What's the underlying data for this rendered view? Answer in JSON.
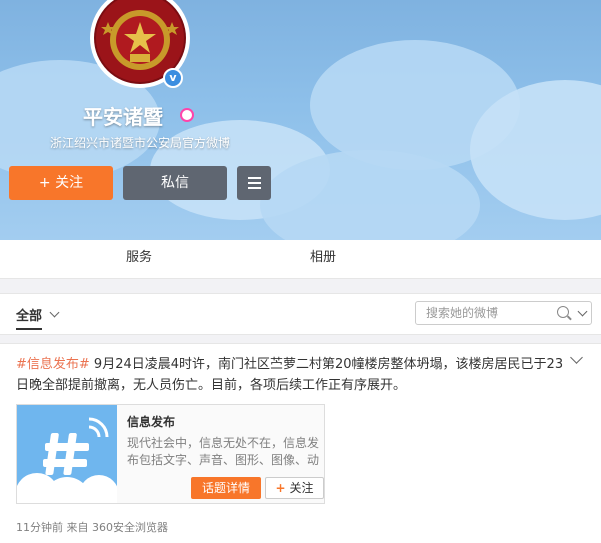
{
  "profile": {
    "name": "平安诸暨",
    "description": "浙江绍兴市诸暨市公安局官方微博",
    "verified_mark": "v"
  },
  "actions": {
    "follow_plus": "+",
    "follow_label": "关注",
    "message_label": "私信",
    "menu_icon": "menu-icon"
  },
  "tabs": [
    {
      "label": "服务"
    },
    {
      "label": "相册"
    }
  ],
  "filter": {
    "selected": "全部",
    "search_placeholder": "搜索她的微博"
  },
  "post": {
    "hashtag": "#信息发布#",
    "text": " 9月24日凌晨4时许，南门社区苎萝二村第20幢楼房整体坍塌，该楼房居民已于23日晚全部提前撤离，无人员伤亡。目前，各项后续工作正有序展开。",
    "link_card": {
      "title": "信息发布",
      "description": "现代社会中，信息无处不在，信息发布包括文字、声音、图形、图像、动",
      "detail_button": "话题详情",
      "follow_plus": "+",
      "follow_label": "关注"
    },
    "meta": "11分钟前 来自 360安全浏览器"
  },
  "colors": {
    "accent_orange": "#f8762a",
    "button_gray": "#5f6671",
    "hashtag": "#eb7350",
    "cover_blue": "#8ec0ea"
  }
}
